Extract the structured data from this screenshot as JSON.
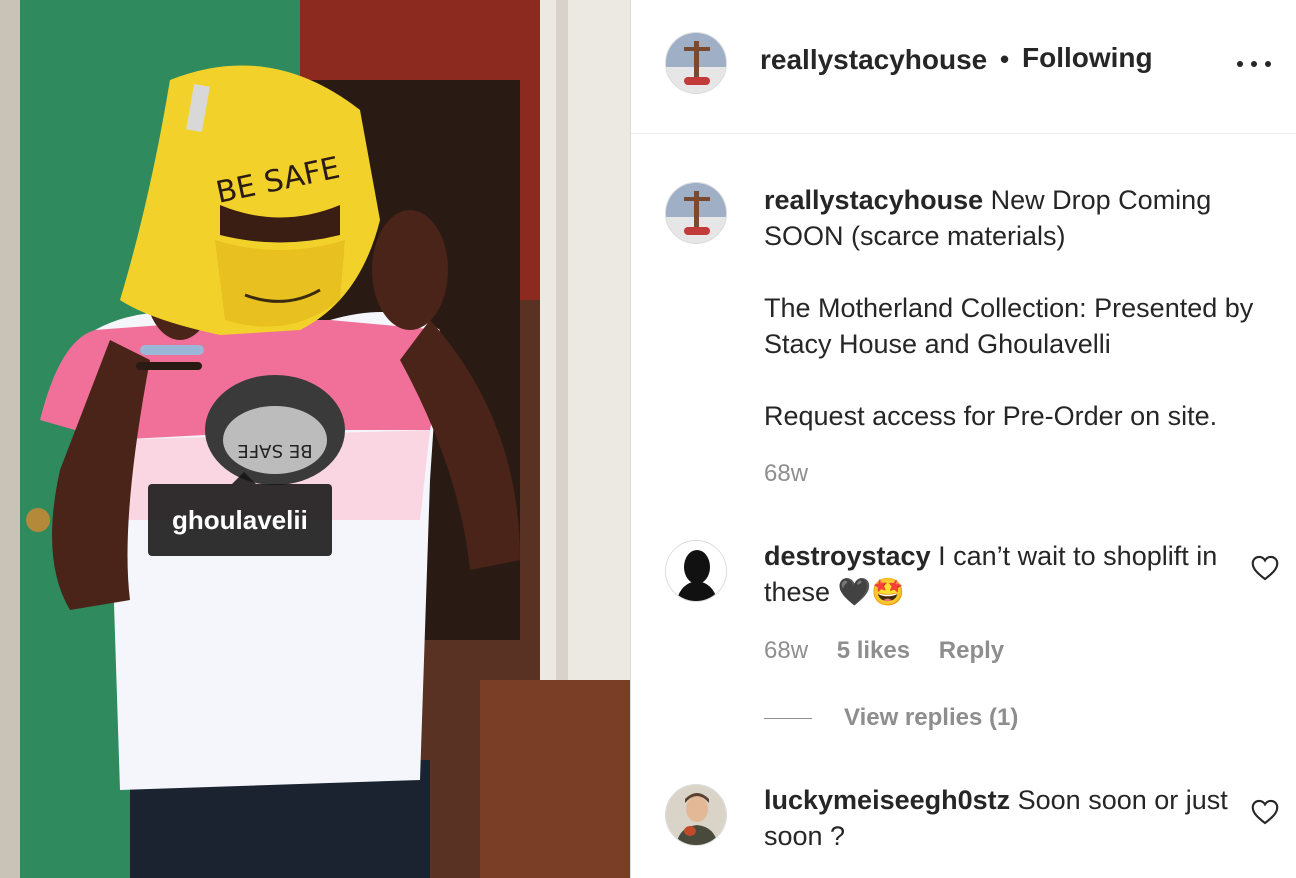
{
  "photo": {
    "tag_label": "ghoulavelii",
    "balaclava_text": "BE SAFE",
    "shirt_text": "BE SAFE"
  },
  "header": {
    "username": "reallystacyhouse",
    "separator": "•",
    "follow_status": "Following"
  },
  "caption": {
    "username": "reallystacyhouse",
    "line1": "New Drop Coming SOON (scarce materials)",
    "line2": "The Motherland Collection: Presented by Stacy House and Ghoulavelli",
    "line3": "Request access for Pre-Order on site.",
    "age": "68w"
  },
  "comments": [
    {
      "username": "destroystacy",
      "text": "I can’t wait to shoplift in these 🖤🤩",
      "age": "68w",
      "likes": "5 likes",
      "reply_label": "Reply",
      "view_replies": "View replies (1)"
    },
    {
      "username": "luckymeiseegh0stz",
      "text": "Soon soon or just soon ?"
    }
  ],
  "icons": {
    "more": "more-options-icon",
    "like": "heart-icon"
  }
}
